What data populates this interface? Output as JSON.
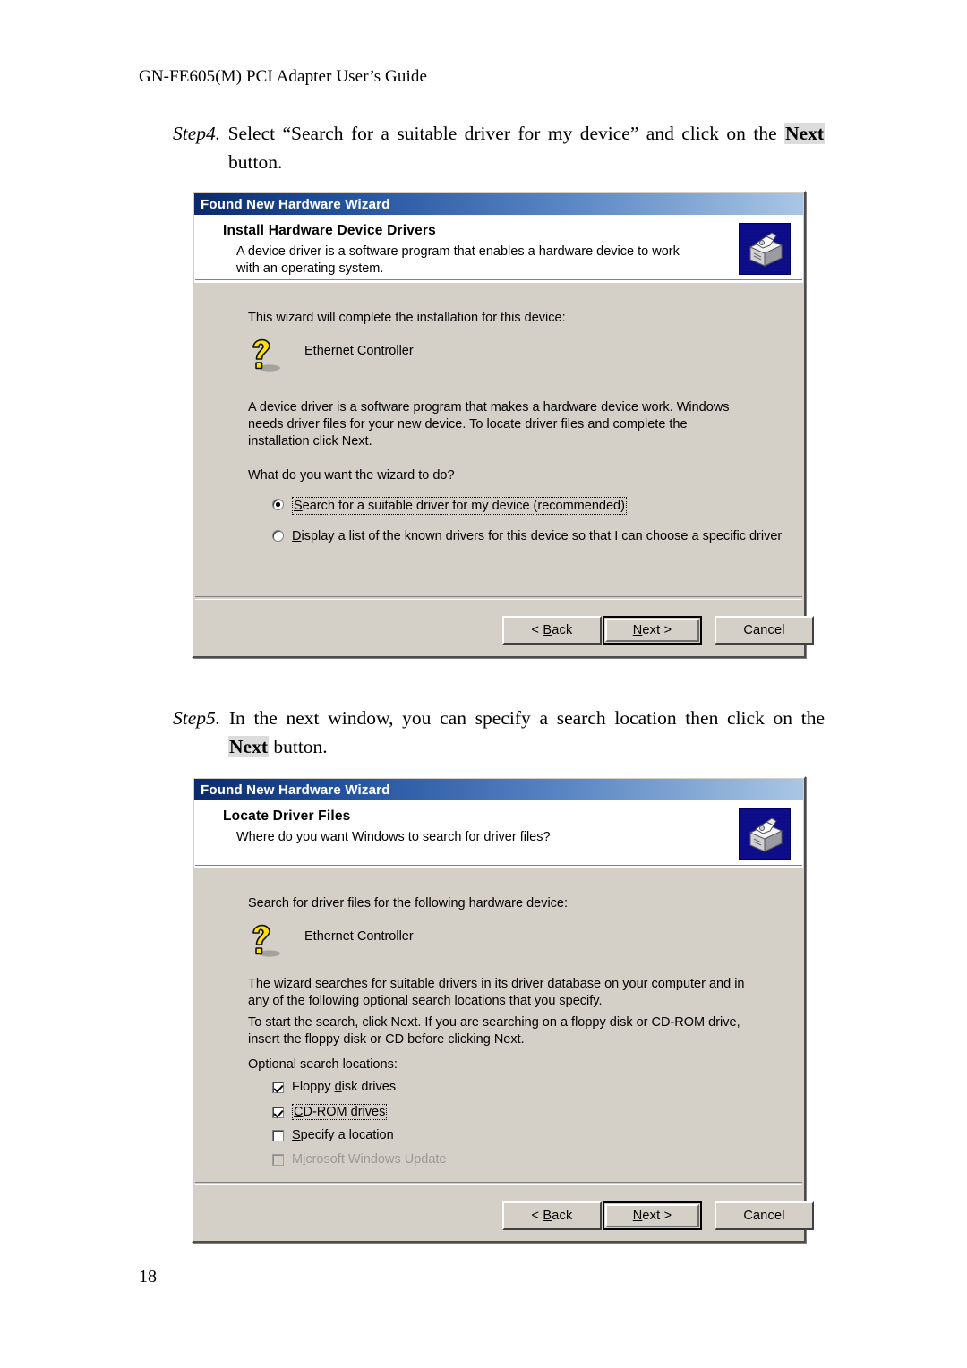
{
  "document": {
    "running_header": "GN-FE605(M) PCI Adapter User’s Guide",
    "page_number": "18",
    "steps": [
      {
        "label": "Step4.",
        "line1_before": "Select “Search for a suitable driver for my device” and click on the",
        "highlight": "Next",
        "line2": "button."
      },
      {
        "label": "Step5.",
        "line1_before": "In the next window, you can specify a search location then click on the",
        "highlight": "Next",
        "line2_after": " button."
      }
    ]
  },
  "dialog1": {
    "title": "Found New Hardware Wizard",
    "icon": "hardware-wizard-icon",
    "header": {
      "title": "Install Hardware Device Drivers",
      "subtitle": "A device driver is a software program that enables a hardware device to work with an operating system."
    },
    "body": {
      "intro": "This wizard will complete the installation for this device:",
      "device_icon": "unknown-device-question-icon",
      "device_name": "Ethernet Controller",
      "paragraph": "A device driver is a software program that makes a hardware device work. Windows needs driver files for your new device. To locate driver files and complete the installation click Next.",
      "question": "What do you want the wizard to do?",
      "options": [
        {
          "id": "search-suitable-driver",
          "accesskey": "S",
          "label_rest": "earch for a suitable driver for my device (recommended)",
          "checked": true,
          "focused": true
        },
        {
          "id": "display-known-drivers",
          "accesskey": "D",
          "label_rest": "isplay a list of the known drivers for this device so that I can choose a specific driver",
          "checked": false,
          "focused": false
        }
      ]
    },
    "buttons": {
      "back": {
        "prefix": "< ",
        "accesskey": "B",
        "rest": "ack"
      },
      "next": {
        "accesskey": "N",
        "rest": "ext",
        "suffix": " >",
        "default": true
      },
      "cancel": {
        "label": "Cancel"
      }
    }
  },
  "dialog2": {
    "title": "Found New Hardware Wizard",
    "icon": "hardware-wizard-icon",
    "header": {
      "title": "Locate Driver Files",
      "subtitle": "Where do you want Windows to search for driver files?"
    },
    "body": {
      "intro": "Search for driver files for the following hardware device:",
      "device_icon": "unknown-device-question-icon",
      "device_name": "Ethernet Controller",
      "paragraph1": "The wizard searches for suitable drivers in its driver database on your computer and in any of the following optional search locations that you specify.",
      "paragraph2": "To start the search, click Next. If you are searching on a floppy disk or CD-ROM drive, insert the floppy disk or CD before clicking Next.",
      "group_label": "Optional search locations:",
      "checkboxes": [
        {
          "id": "floppy-disk-drives",
          "pre": "Floppy ",
          "accesskey": "d",
          "rest": "isk drives",
          "checked": true,
          "focused": false,
          "disabled": false
        },
        {
          "id": "cd-rom-drives",
          "pre": "",
          "accesskey": "C",
          "rest": "D-ROM drives",
          "checked": true,
          "focused": true,
          "disabled": false
        },
        {
          "id": "specify-a-location",
          "pre": "",
          "accesskey": "S",
          "rest": "pecify a location",
          "checked": false,
          "focused": false,
          "disabled": false
        },
        {
          "id": "microsoft-windows-update",
          "pre": "M",
          "accesskey": "i",
          "rest": "crosoft Windows Update",
          "checked": false,
          "focused": false,
          "disabled": true
        }
      ]
    },
    "buttons": {
      "back": {
        "prefix": "< ",
        "accesskey": "B",
        "rest": "ack"
      },
      "next": {
        "accesskey": "N",
        "rest": "ext",
        "suffix": " >",
        "default": true
      },
      "cancel": {
        "label": "Cancel"
      }
    }
  },
  "colors": {
    "titlebar_dark": "#0a2a6c",
    "titlebar_light": "#a9c6e4",
    "dialog_face": "#d4d0c8",
    "icon_blue": "#0b0b8c",
    "qmark_yellow": "#ffe000",
    "highlight_gray": "#dcdcdc"
  }
}
